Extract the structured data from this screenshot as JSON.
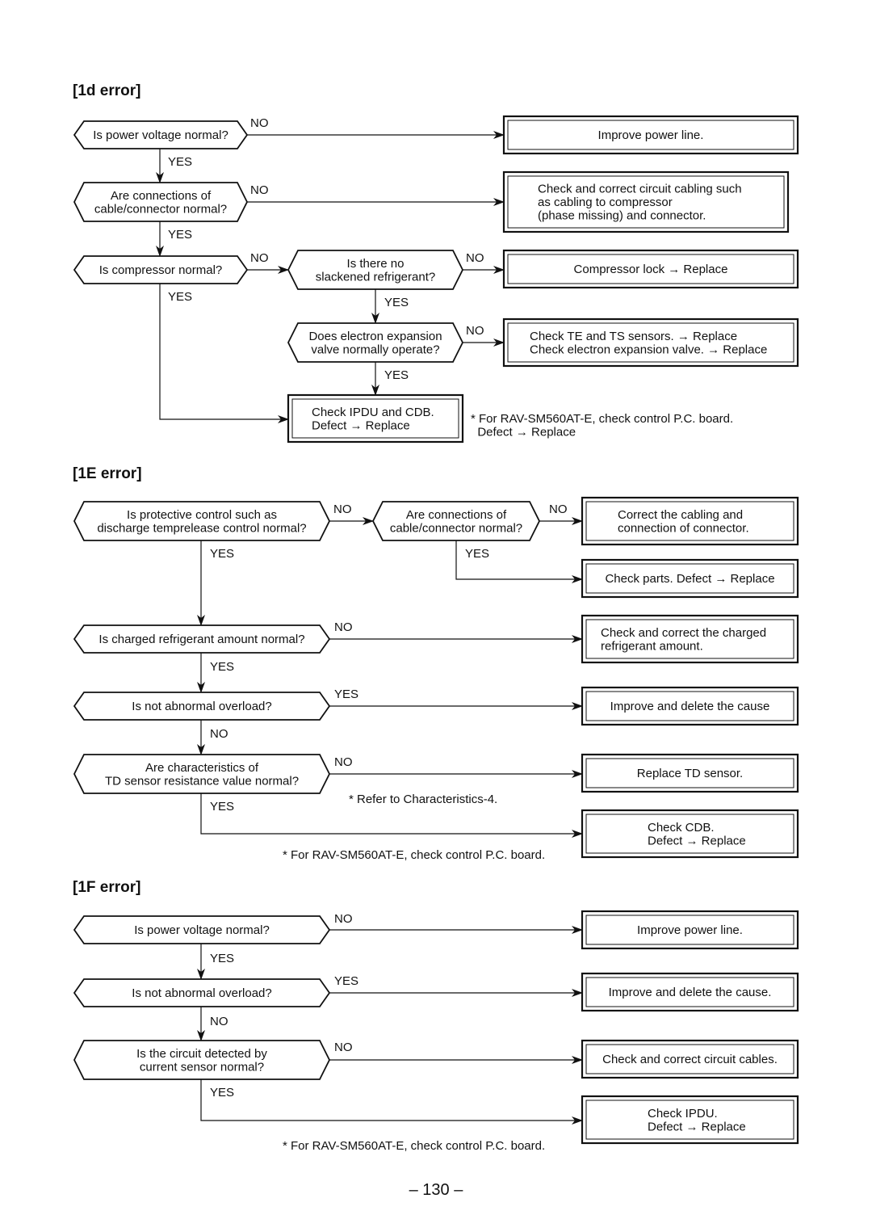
{
  "page_number": "– 130 –",
  "sections": [
    {
      "id": "1d",
      "title": "[1d error]",
      "decisions": [
        {
          "id": "d1",
          "lines": [
            "Is power voltage normal?"
          ]
        },
        {
          "id": "d2",
          "lines": [
            "Are connections of",
            "cable/connector normal?"
          ]
        },
        {
          "id": "d3",
          "lines": [
            "Is compressor normal?"
          ]
        },
        {
          "id": "d4",
          "lines": [
            "Is there no",
            "slackened refrigerant?"
          ]
        },
        {
          "id": "d5",
          "lines": [
            "Does electron expansion",
            "valve normally operate?"
          ]
        }
      ],
      "actions": [
        {
          "id": "a1",
          "lines": [
            "Improve power line."
          ]
        },
        {
          "id": "a2",
          "lines": [
            "Check and correct circuit cabling such",
            "as cabling to compressor",
            "(phase missing) and connector."
          ]
        },
        {
          "id": "a3",
          "lines": [
            "Compressor lock → Replace"
          ]
        },
        {
          "id": "a4",
          "lines": [
            "Check TE and TS sensors. → Replace",
            "Check electron expansion valve. → Replace"
          ]
        },
        {
          "id": "a5",
          "lines": [
            "Check IPDU and CDB.",
            "Defect → Replace"
          ]
        }
      ],
      "edges": [
        {
          "from": "d1",
          "to": "a1",
          "label": "NO"
        },
        {
          "from": "d1",
          "to": "d2",
          "label": "YES"
        },
        {
          "from": "d2",
          "to": "a2",
          "label": "NO"
        },
        {
          "from": "d2",
          "to": "d3",
          "label": "YES"
        },
        {
          "from": "d3",
          "to": "d4",
          "label": "NO"
        },
        {
          "from": "d3",
          "to": "a5",
          "label": "YES"
        },
        {
          "from": "d4",
          "to": "a3",
          "label": "NO"
        },
        {
          "from": "d4",
          "to": "d5",
          "label": "YES"
        },
        {
          "from": "d5",
          "to": "a4",
          "label": "NO"
        },
        {
          "from": "d5",
          "to": "a5",
          "label": "YES"
        }
      ],
      "notes": [
        {
          "id": "n1",
          "lines": [
            "* For RAV-SM560AT-E, check control P.C. board.",
            "  Defect → Replace"
          ]
        }
      ]
    },
    {
      "id": "1E",
      "title": "[1E error]",
      "decisions": [
        {
          "id": "d1",
          "lines": [
            "Is protective control such as",
            "discharge temprelease control normal?"
          ]
        },
        {
          "id": "d2",
          "lines": [
            "Are connections of",
            "cable/connector normal?"
          ]
        },
        {
          "id": "d3",
          "lines": [
            "Is charged refrigerant amount normal?"
          ]
        },
        {
          "id": "d4",
          "lines": [
            "Is not abnormal overload?"
          ]
        },
        {
          "id": "d5",
          "lines": [
            "Are characteristics of",
            "TD sensor resistance value normal?"
          ]
        }
      ],
      "actions": [
        {
          "id": "a1",
          "lines": [
            "Correct the cabling and",
            "connection of connector."
          ]
        },
        {
          "id": "a2",
          "lines": [
            "Check parts. Defect → Replace"
          ]
        },
        {
          "id": "a3",
          "lines": [
            "Check and correct the charged",
            "refrigerant amount."
          ]
        },
        {
          "id": "a4",
          "lines": [
            "Improve and delete the cause"
          ]
        },
        {
          "id": "a5",
          "lines": [
            "Replace TD sensor."
          ]
        },
        {
          "id": "a6",
          "lines": [
            "Check CDB.",
            "Defect → Replace"
          ]
        }
      ],
      "edges": [
        {
          "from": "d1",
          "to": "d2",
          "label": "NO"
        },
        {
          "from": "d1",
          "to": "d3",
          "label": "YES"
        },
        {
          "from": "d2",
          "to": "a1",
          "label": "NO"
        },
        {
          "from": "d2",
          "to": "a2",
          "label": "YES"
        },
        {
          "from": "d3",
          "to": "a3",
          "label": "NO"
        },
        {
          "from": "d3",
          "to": "d4",
          "label": "YES"
        },
        {
          "from": "d4",
          "to": "a4",
          "label": "YES"
        },
        {
          "from": "d4",
          "to": "d5",
          "label": "NO"
        },
        {
          "from": "d5",
          "to": "a5",
          "label": "NO"
        },
        {
          "from": "d5",
          "to": "a6",
          "label": "YES"
        }
      ],
      "notes": [
        {
          "id": "n1",
          "lines": [
            "* Refer to Characteristics-4."
          ]
        },
        {
          "id": "n2",
          "lines": [
            "* For RAV-SM560AT-E, check control P.C. board."
          ]
        }
      ]
    },
    {
      "id": "1F",
      "title": "[1F error]",
      "decisions": [
        {
          "id": "d1",
          "lines": [
            "Is power voltage normal?"
          ]
        },
        {
          "id": "d2",
          "lines": [
            "Is not abnormal overload?"
          ]
        },
        {
          "id": "d3",
          "lines": [
            "Is the circuit detected by",
            "current sensor normal?"
          ]
        }
      ],
      "actions": [
        {
          "id": "a1",
          "lines": [
            "Improve power line."
          ]
        },
        {
          "id": "a2",
          "lines": [
            "Improve and delete the cause."
          ]
        },
        {
          "id": "a3",
          "lines": [
            "Check and correct circuit cables."
          ]
        },
        {
          "id": "a4",
          "lines": [
            "Check IPDU.",
            "Defect → Replace"
          ]
        }
      ],
      "edges": [
        {
          "from": "d1",
          "to": "a1",
          "label": "NO"
        },
        {
          "from": "d1",
          "to": "d2",
          "label": "YES"
        },
        {
          "from": "d2",
          "to": "a2",
          "label": "YES"
        },
        {
          "from": "d2",
          "to": "d3",
          "label": "NO"
        },
        {
          "from": "d3",
          "to": "a3",
          "label": "NO"
        },
        {
          "from": "d3",
          "to": "a4",
          "label": "YES"
        }
      ],
      "notes": [
        {
          "id": "n1",
          "lines": [
            "* For RAV-SM560AT-E, check control P.C. board."
          ]
        }
      ]
    }
  ]
}
